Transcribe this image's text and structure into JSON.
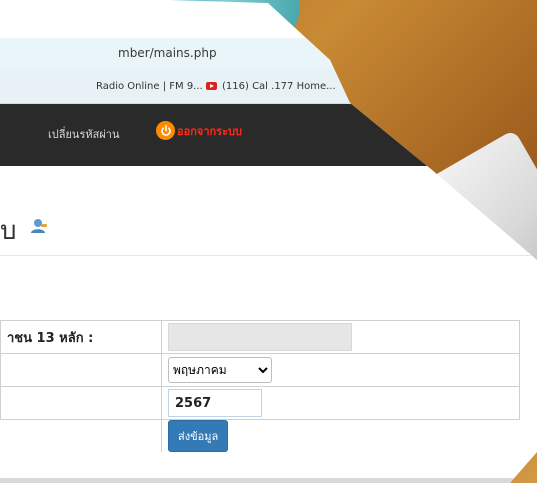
{
  "browser": {
    "url_fragment": "mber/mains.php",
    "bookmarks": [
      {
        "label": "Radio Online | FM 9..."
      },
      {
        "label": "(116) Cal .177 Home..."
      }
    ]
  },
  "nav": {
    "change_password": "เปลี่ยนรหัสผ่าน",
    "logout": "ออกจากระบบ"
  },
  "page": {
    "title_fragment": "บ"
  },
  "form": {
    "rows": [
      {
        "label": "าชน 13 หลัก :",
        "value": ""
      },
      {
        "label": "",
        "selected_month": "พฤษภาคม"
      },
      {
        "label": "",
        "year": "2567"
      }
    ],
    "submit_label": "ส่งข้อมูล"
  },
  "colors": {
    "navbar": "#2a2a2a",
    "logout": "#ff2a1a",
    "power_icon": "#ff8c00",
    "submit": "#337ab7"
  },
  "icons": [
    "power-icon",
    "youtube-icon",
    "user-icon",
    "chevron-down-icon"
  ]
}
